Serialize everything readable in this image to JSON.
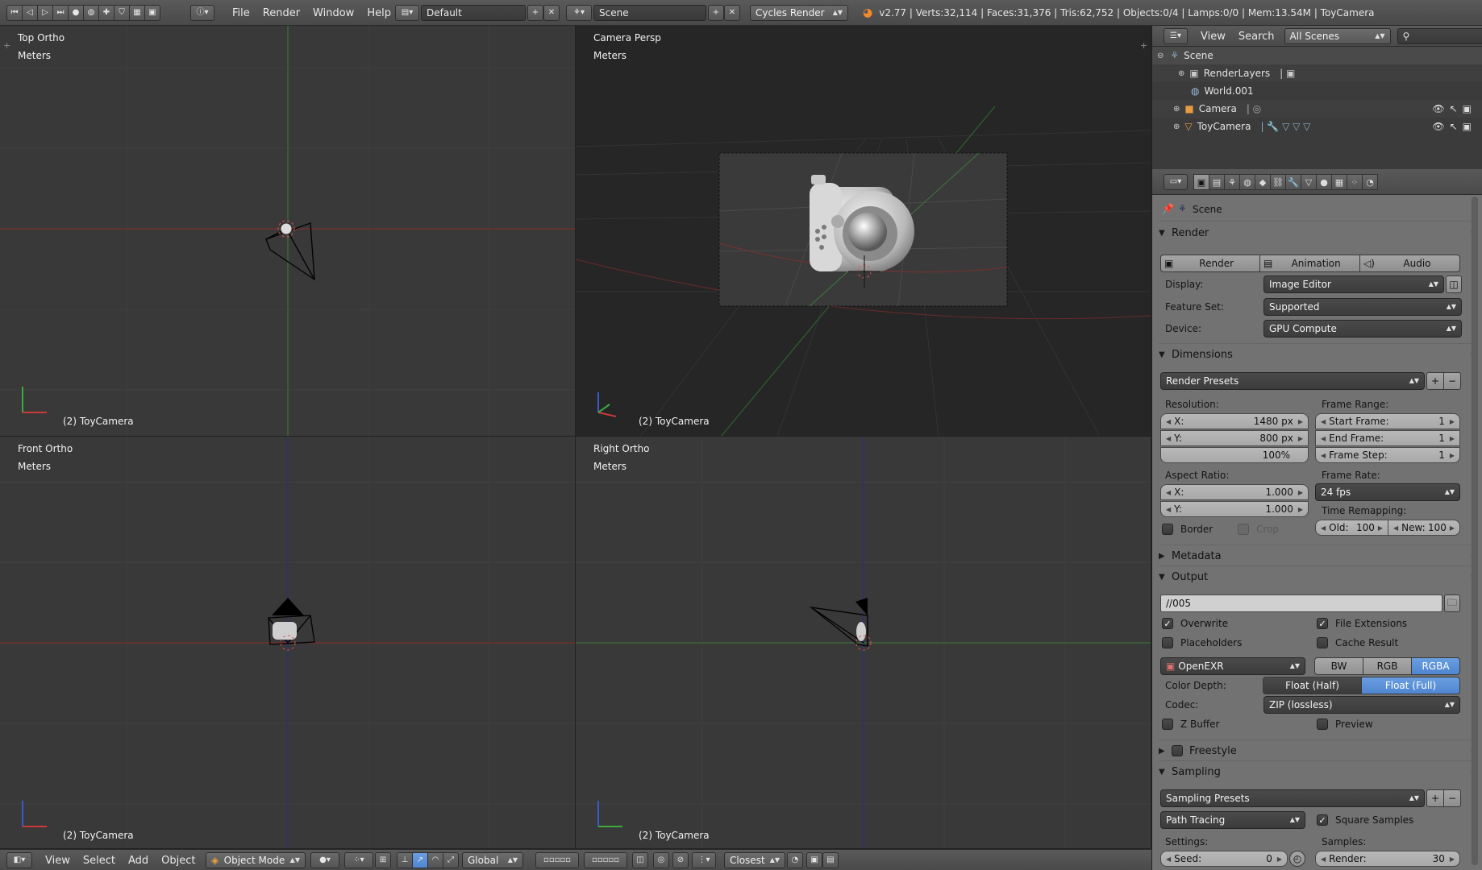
{
  "topbar": {
    "menus": [
      "File",
      "Render",
      "Window",
      "Help"
    ],
    "layout": "Default",
    "scene": "Scene",
    "engine": "Cycles Render",
    "stats": "v2.77 | Verts:32,114 | Faces:31,376 | Tris:62,752 | Objects:0/4 | Lamps:0/0 | Mem:13.54M | ToyCamera"
  },
  "viewports": {
    "top": {
      "name": "Top Ortho",
      "units": "Meters",
      "object": "(2) ToyCamera"
    },
    "camera": {
      "name": "Camera Persp",
      "units": "Meters",
      "object": "(2) ToyCamera"
    },
    "front": {
      "name": "Front Ortho",
      "units": "Meters",
      "object": "(2) ToyCamera"
    },
    "right": {
      "name": "Right Ortho",
      "units": "Meters",
      "object": "(2) ToyCamera"
    }
  },
  "bottombar": {
    "menus": [
      "View",
      "Select",
      "Add",
      "Object"
    ],
    "mode": "Object Mode",
    "orientation": "Global",
    "snap": "Closest"
  },
  "outliner": {
    "menus": [
      "View",
      "Search"
    ],
    "filter": "All Scenes",
    "items": [
      "Scene",
      "RenderLayers",
      "World.001",
      "Camera",
      "ToyCamera"
    ]
  },
  "props": {
    "context": "Scene",
    "render": {
      "title": "Render",
      "buttons": [
        "Render",
        "Animation",
        "Audio"
      ],
      "display_label": "Display:",
      "display": "Image Editor",
      "featureset_label": "Feature Set:",
      "featureset": "Supported",
      "device_label": "Device:",
      "device": "GPU Compute"
    },
    "dimensions": {
      "title": "Dimensions",
      "presets": "Render Presets",
      "resolution_label": "Resolution:",
      "res_x_label": "X:",
      "res_x": "1480 px",
      "res_y_label": "Y:",
      "res_y": "800 px",
      "res_pct": "100%",
      "aspect_label": "Aspect Ratio:",
      "asp_x_label": "X:",
      "asp_x": "1.000",
      "asp_y_label": "Y:",
      "asp_y": "1.000",
      "border": "Border",
      "crop": "Crop",
      "frame_range_label": "Frame Range:",
      "start_label": "Start Frame:",
      "start": "1",
      "end_label": "End Frame:",
      "end": "1",
      "step_label": "Frame Step:",
      "step": "1",
      "frame_rate_label": "Frame Rate:",
      "frame_rate": "24 fps",
      "remap_label": "Time Remapping:",
      "old_label": "Old:",
      "old": "100",
      "new_label": "New:",
      "new": "100"
    },
    "metadata": {
      "title": "Metadata"
    },
    "output": {
      "title": "Output",
      "path": "//005",
      "overwrite": "Overwrite",
      "file_ext": "File Extensions",
      "placeholders": "Placeholders",
      "cache": "Cache Result",
      "format": "OpenEXR",
      "channels": [
        "BW",
        "RGB",
        "RGBA"
      ],
      "depth_label": "Color Depth:",
      "depths": [
        "Float (Half)",
        "Float (Full)"
      ],
      "codec_label": "Codec:",
      "codec": "ZIP (lossless)",
      "zbuffer": "Z Buffer",
      "preview": "Preview"
    },
    "freestyle": {
      "title": "Freestyle"
    },
    "sampling": {
      "title": "Sampling",
      "presets": "Sampling Presets",
      "integrator": "Path Tracing",
      "square": "Square Samples",
      "settings_label": "Settings:",
      "samples_label": "Samples:",
      "seed_label": "Seed:",
      "seed": "0",
      "render_label": "Render:",
      "render": "30"
    }
  },
  "colors": {
    "accent_blue": "#5a8fd6",
    "viewport_bg": "#393939",
    "persp_bg": "#262626",
    "props_bg": "#727272"
  }
}
